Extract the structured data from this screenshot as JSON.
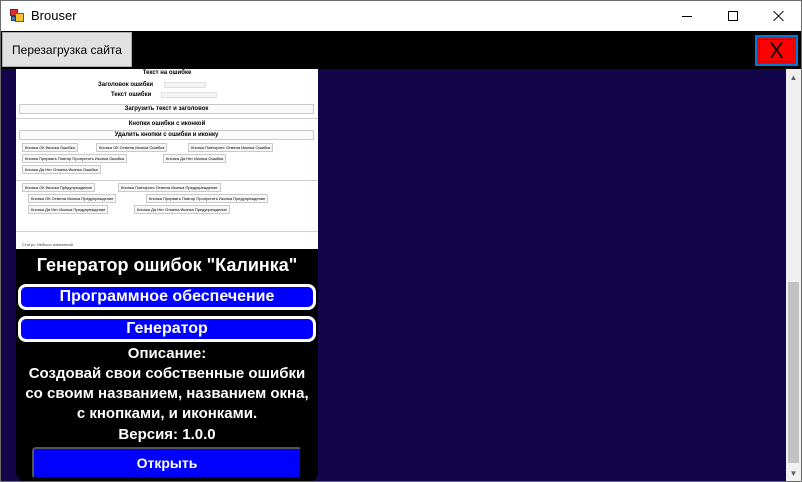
{
  "window": {
    "title": "Brouser",
    "icon": "app-icon"
  },
  "toolbar": {
    "reload_label": "Перезагрузка сайта",
    "exit_label": "X",
    "exit_color": "#ff0000"
  },
  "content": {
    "background": "#12054a"
  },
  "card": {
    "title": "Генератор ошибок \"Калинка\"",
    "category_label": "Программное обеспечение",
    "type_label": "Генератор",
    "description_heading": "Описание:",
    "description_lines": [
      "Создовай свои собственные ошибки",
      "со своим названием, названием окна,",
      "с кнопками, и иконками."
    ],
    "version": "Версия: 1.0.0",
    "open_label": "Открыть",
    "accent": "#0000ff"
  },
  "preview": {
    "section1_title": "Текст на ошибке",
    "header_label": "Заголовок ошибки",
    "text_label": "Текст ошибки",
    "load_button": "Загрузить текст и заголовок",
    "section2_title": "Кнопки ошибки с иконкой",
    "delete_button": "Удалить кнопки с ошибки и иконку",
    "error_buttons": [
      "Кнопка ОК Иконка Ошибка",
      "Кнопка ОК Отмена Иконка Ошибка",
      "Кнопка Повторить Отмена Иконка Ошибка",
      "Кнопка Прервать Повтор Пропустить Иконка Ошибка",
      "Кнопка Да Нет Иконка Ошибка",
      "Кнопка Да Нет Отмена Иконка Ошибка"
    ],
    "warning_buttons": [
      "Кнопка ОК Иконка Предупреждение",
      "Кнопка Повторить Отмена Иконка Предупреждение",
      "Кнопка ОК Отмена Иконка Предупреждение",
      "Кнопка Прервать Повтор Пропустить Иконка Предупреждение",
      "Кнопка Да Нет Иконка Предупреждение",
      "Кнопка Да Нет Отмена Иконка Предупреждение"
    ],
    "status": "Статус: Небыло изменений"
  }
}
